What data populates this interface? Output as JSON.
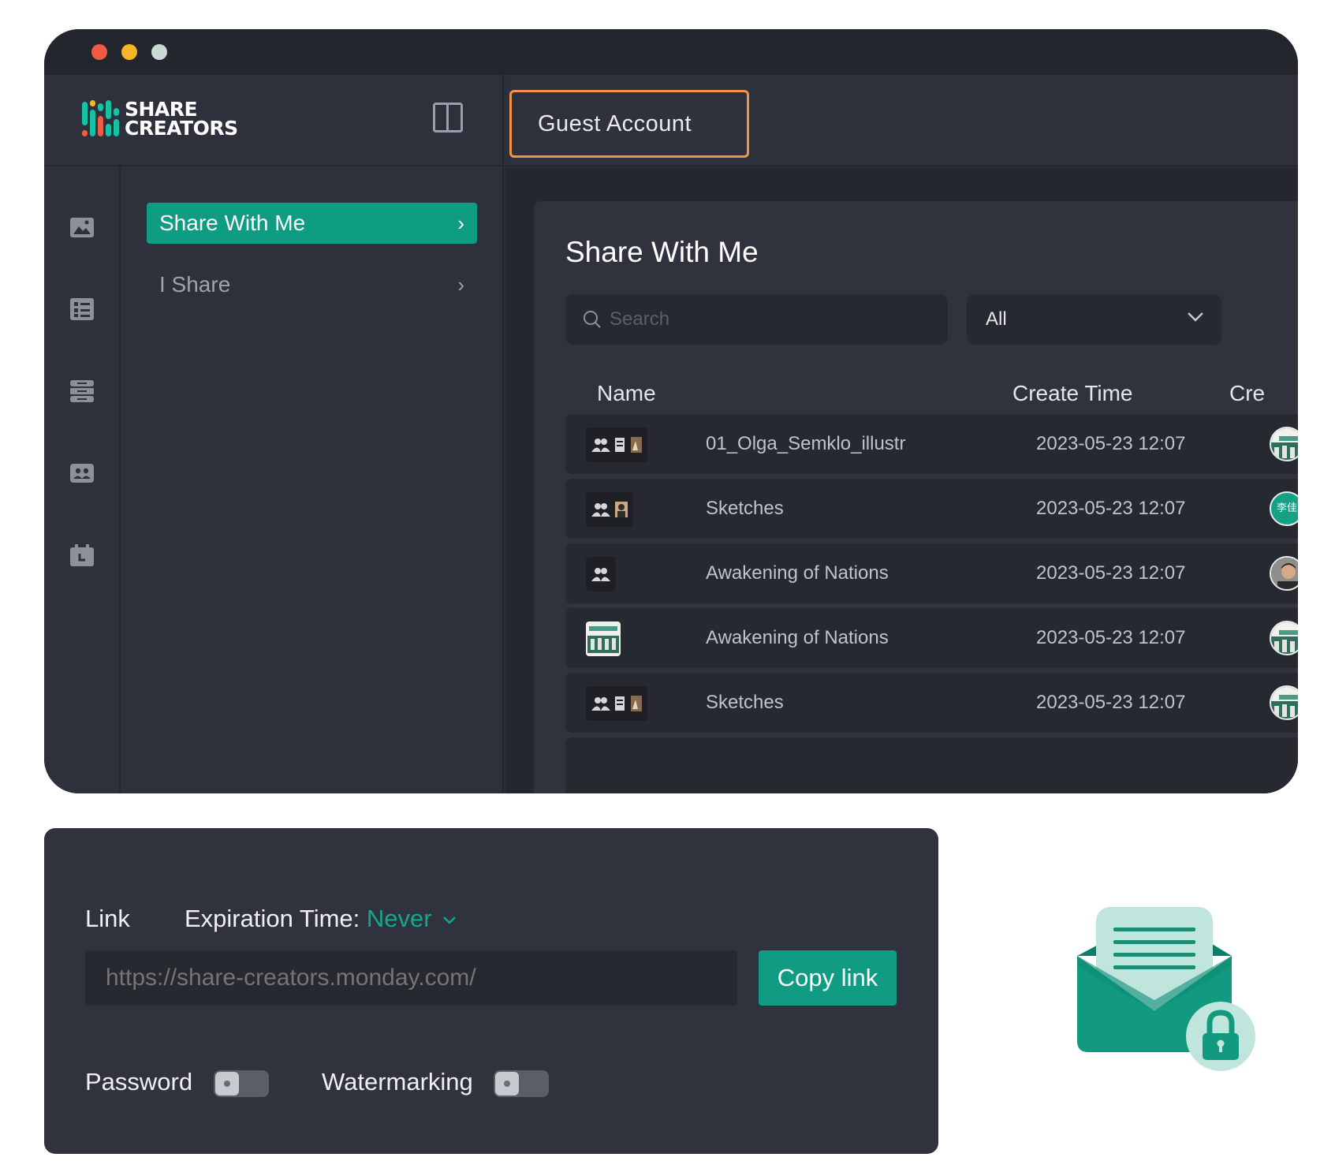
{
  "window": {
    "traffic_lights": [
      "close",
      "minimize",
      "zoom"
    ]
  },
  "brand": {
    "line1": "SHARE",
    "line2": "CREATORS"
  },
  "header": {
    "account_button": "Guest Account"
  },
  "rail": {
    "icons": [
      "image-icon",
      "list-icon",
      "storage-icon",
      "team-icon",
      "calendar-icon"
    ]
  },
  "nav": {
    "items": [
      {
        "label": "Share With Me",
        "active": true
      },
      {
        "label": "I Share",
        "active": false
      }
    ]
  },
  "main": {
    "title": "Share With Me",
    "search_placeholder": "Search",
    "filter_value": "All",
    "columns": [
      "Name",
      "Create Time",
      "Cre"
    ],
    "rows": [
      {
        "name": "01_Olga_Semklo_illustr",
        "time": "2023-05-23 12:07"
      },
      {
        "name": "Sketches",
        "time": "2023-05-23 12:07"
      },
      {
        "name": "Awakening of Nations",
        "time": "2023-05-23 12:07"
      },
      {
        "name": "Awakening of Nations",
        "time": "2023-05-23 12:07"
      },
      {
        "name": "Sketches",
        "time": "2023-05-23 12:07"
      }
    ],
    "avatar_text": "李佳"
  },
  "share": {
    "link_label": "Link",
    "expiration_label": "Expiration Time:",
    "expiration_value": "Never",
    "link_placeholder": "https://share-creators.monday.com/",
    "copy_button": "Copy link",
    "password_label": "Password",
    "password_on": false,
    "watermark_label": "Watermarking",
    "watermark_on": false
  },
  "colors": {
    "accent": "#0e9c82",
    "orange_border": "#f0934a",
    "window_bg": "#2b2e37"
  }
}
